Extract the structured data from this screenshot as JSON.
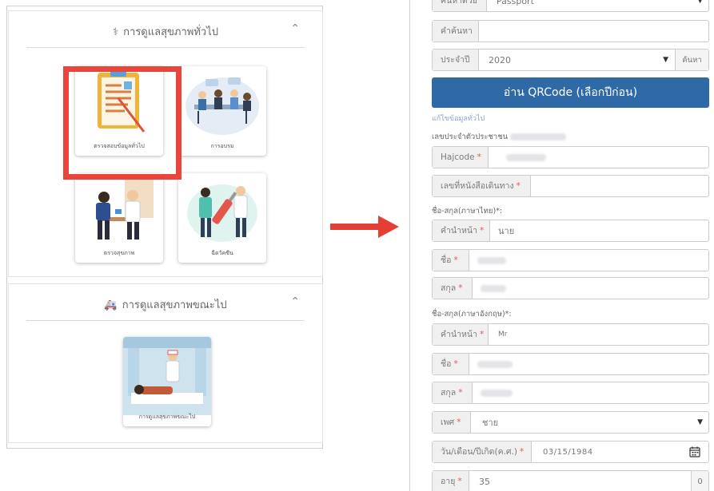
{
  "left": {
    "section1": {
      "title": "การดูแลสุขภาพทั่วไป",
      "cards": [
        {
          "caption": "ตรวจสอบข้อมูลทั่วไป"
        },
        {
          "caption": "การอบรม"
        },
        {
          "caption": "ตรวจสุขภาพ"
        },
        {
          "caption": "ฉีดวัคซีน"
        }
      ]
    },
    "section2": {
      "title": "การดูแลสุขภาพขณะไป",
      "cards": [
        {
          "caption": "การดูแลสุขภาพขณะไป"
        }
      ]
    }
  },
  "form": {
    "search_by": {
      "label": "ค้นหาด้วย",
      "value": "Passport"
    },
    "keyword": {
      "label": "คำค้นหา",
      "value": ""
    },
    "year": {
      "label": "ประจำปี",
      "value": "2020",
      "search_button": "ค้นหา"
    },
    "qr_button": "อ่าน QRCode (เลือกปีก่อน)",
    "edit_link": "แก้ไขข้อมูลทั่วไป",
    "citizen_id_label": "เลขประจำตัวประชาชน",
    "hajcode": {
      "label": "Hajcode",
      "req": "*"
    },
    "passport_no": {
      "label": "เลขที่หนังสือเดินทาง",
      "req": "*"
    },
    "thai_name_heading": "ชื่อ-สกุล(ภาษาไทย)*:",
    "th_title": {
      "label": "คำนำหน้า",
      "req": "*",
      "value": "นาย"
    },
    "th_first": {
      "label": "ชื่อ",
      "req": "*"
    },
    "th_last": {
      "label": "สกุล",
      "req": "*"
    },
    "eng_name_heading": "ชื่อ-สกุล(ภาษาอังกฤษ)*:",
    "en_title": {
      "label": "คำนำหน้า",
      "req": "*",
      "value": "Mr"
    },
    "en_first": {
      "label": "ชื่อ",
      "req": "*"
    },
    "en_last": {
      "label": "สกุล",
      "req": "*"
    },
    "gender": {
      "label": "เพศ",
      "req": "*",
      "value": "ชาย"
    },
    "dob": {
      "label": "วัน/เดือน/ปีเกิด(ค.ศ.)",
      "req": "*",
      "value": "03/15/1984"
    },
    "age": {
      "label": "อายุ",
      "req": "*",
      "value": "35",
      "stepper": "0"
    }
  },
  "colors": {
    "highlight": "#e9453b",
    "primary_button": "#2f6aa6",
    "arrow": "#e53e35"
  }
}
